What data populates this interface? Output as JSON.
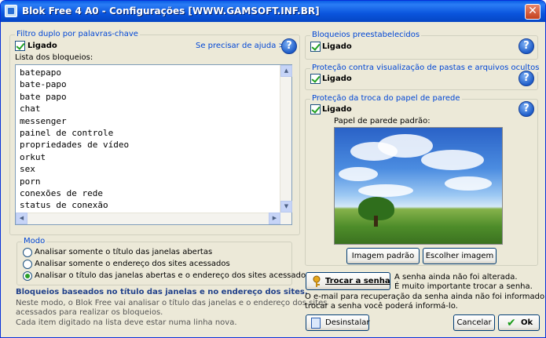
{
  "window": {
    "title": "Blok Free 4 A0 - Configurações [WWW.GAMSOFT.INF.BR]",
    "close_glyph": "✕"
  },
  "filter": {
    "legend": "Filtro duplo por palavras-chave",
    "enabled_label": "Ligado",
    "help_link": "Se precisar de ajuda >",
    "list_label": "Lista dos bloqueios:",
    "list_items": [
      "batepapo",
      "bate-papo",
      "bate papo",
      "chat",
      "messenger",
      "painel de controle",
      "propriedades de vídeo",
      "orkut",
      "sex",
      "porn",
      "conexões de rede",
      "status de conexão"
    ]
  },
  "mode": {
    "legend": "Modo",
    "options": [
      "Analisar somente o título das janelas abertas",
      "Analisar somente o endereço dos sites acessados",
      "Analisar o título das janelas abertas e o endereço dos sites acessados"
    ],
    "selected_index": 2
  },
  "info": {
    "bold_line": "Bloqueios baseados no título das janelas e no endereço dos sites.",
    "line1": "Neste modo, o Blok Free vai analisar o título das janelas e o endereço dos sites",
    "line2": "acessados para realizar os bloqueios.",
    "line3": "Cada item digitado na lista deve estar numa linha nova."
  },
  "preset": {
    "legend": "Bloqueios preestabelecidos",
    "enabled_label": "Ligado"
  },
  "folders": {
    "legend": "Proteção contra visualização de pastas e arquivos ocultos",
    "enabled_label": "Ligado"
  },
  "wallpaper": {
    "legend": "Proteção da troca do papel de parede",
    "enabled_label": "Ligado",
    "caption": "Papel de parede padrão:",
    "default_image_button": "Imagem padrão",
    "choose_image_button": "Escolher imagem"
  },
  "password": {
    "button": "Trocar a senha",
    "status1": "A senha ainda não foi alterada.",
    "status2": "É muito importante trocar a senha.",
    "email1": "O e-mail para recuperação da senha ainda não foi informado, ao",
    "email2": "trocar a senha você poderá informá-lo."
  },
  "footer": {
    "uninstall": "Desinstalar",
    "cancel": "Cancelar",
    "ok": "Ok"
  },
  "help_glyph": "?",
  "scroll": {
    "up": "▲",
    "down": "▼",
    "left": "◀",
    "right": "▶"
  }
}
